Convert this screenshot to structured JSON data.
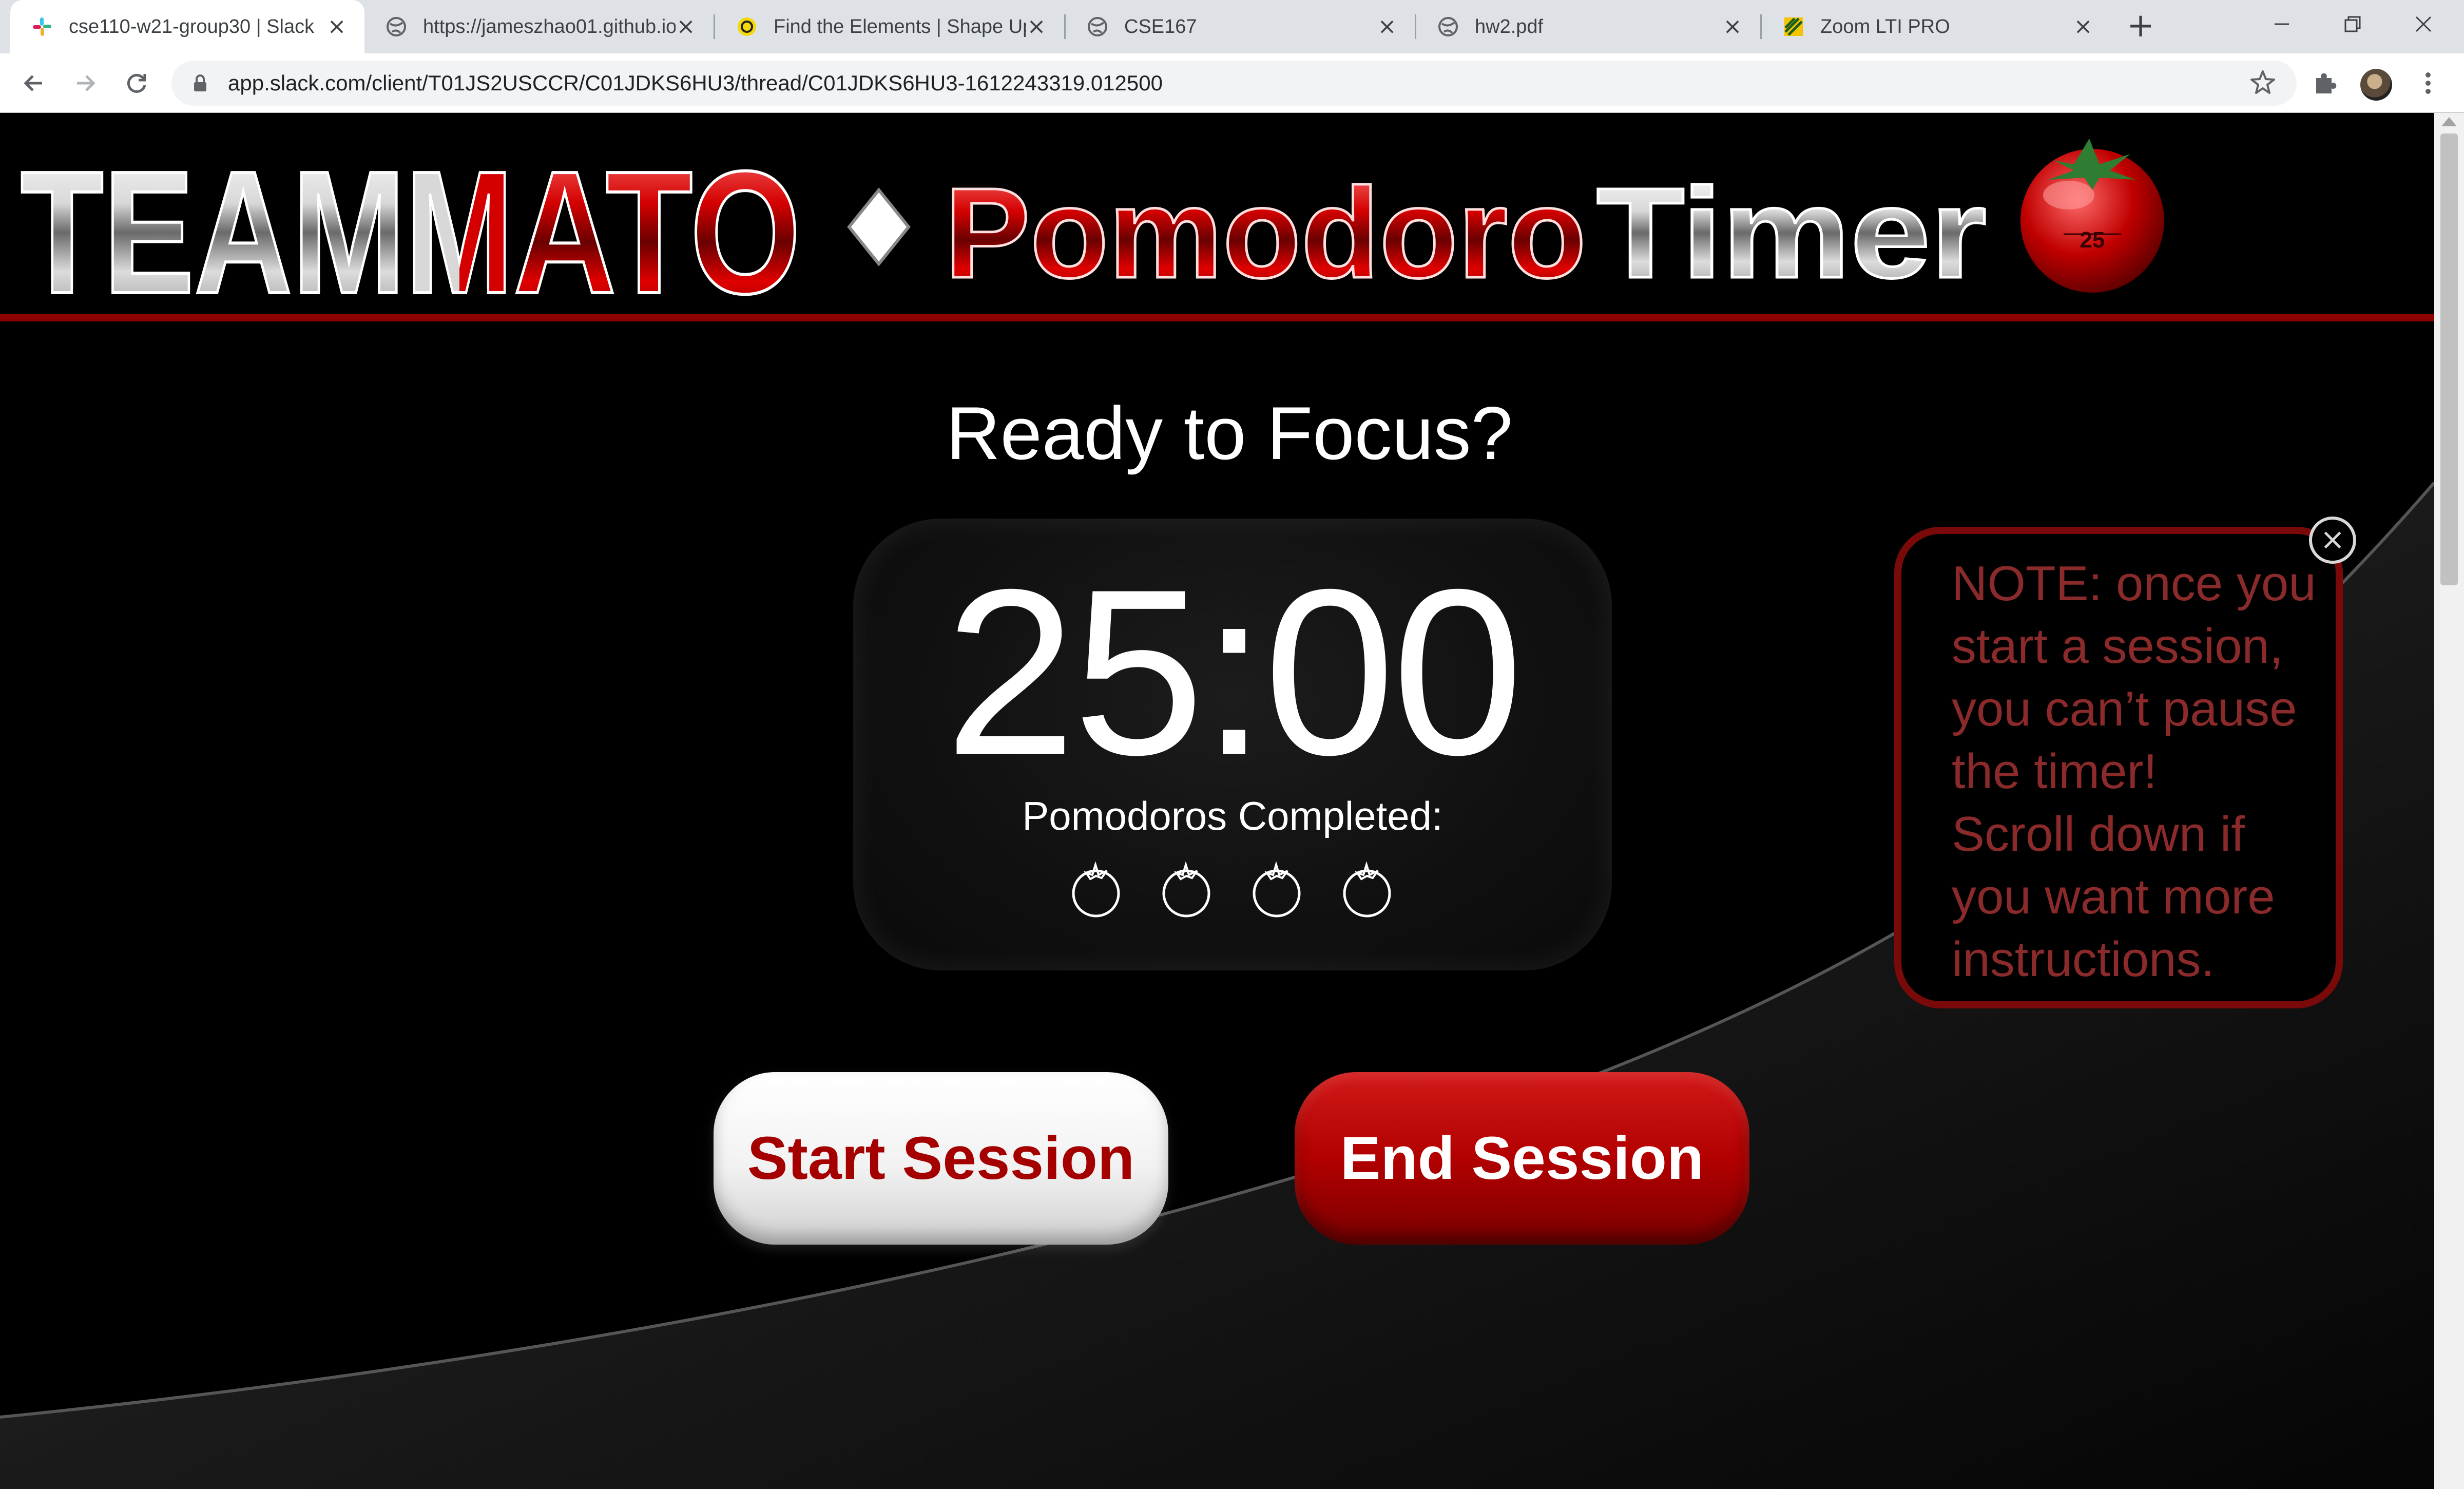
{
  "browser": {
    "tabs": [
      {
        "title": "cse110-w21-group30 | Slack",
        "icon": "slack-icon",
        "active": true
      },
      {
        "title": "https://jameszhao01.github.io",
        "icon": "globe-icon"
      },
      {
        "title": "Find the Elements | Shape Up",
        "icon": "shapeup-icon"
      },
      {
        "title": "CSE167",
        "icon": "globe-icon"
      },
      {
        "title": "hw2.pdf",
        "icon": "globe-icon"
      },
      {
        "title": "Zoom LTI PRO",
        "icon": "zoom-lti-icon"
      }
    ],
    "close_glyph": "×",
    "new_tab_glyph": "+",
    "url": "app.slack.com/client/T01JS2USCCR/C01JDKS6HU3/thread/C01JDKS6HU3-1612243319.012500"
  },
  "banner": {
    "brand_left": "TEAM",
    "brand_right": "ATO",
    "brand_m": "M",
    "title_red": "Pomodoro",
    "title_silver": "Timer",
    "logo_number": "25"
  },
  "main": {
    "heading": "Ready to Focus?",
    "time": "25:00",
    "completed_label": "Pomodoros Completed:",
    "pomodoros_completed": 0,
    "pomodoros_total": 4
  },
  "buttons": {
    "start": "Start Session",
    "end": "End Session"
  },
  "note": {
    "lines": [
      "NOTE: once you",
      "start a session,",
      "you can’t pause",
      "the timer!",
      "Scroll down if",
      "you want more",
      "instructions."
    ],
    "close_glyph": "×"
  },
  "colors": {
    "accent_red": "#a40000",
    "note_border": "#7a0a0a",
    "note_text": "#8b2a2a"
  }
}
